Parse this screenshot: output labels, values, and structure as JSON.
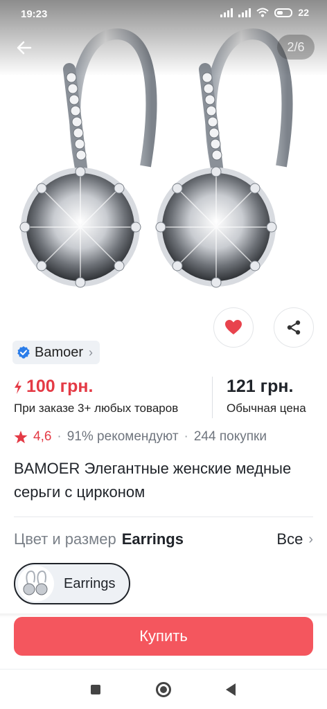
{
  "status_bar": {
    "time": "19:23",
    "battery": "22"
  },
  "gallery": {
    "counter": "2/6"
  },
  "seller": {
    "name": "Bamoer"
  },
  "price": {
    "promo": "100 грн.",
    "promo_note": "При заказе 3+ любых товаров",
    "regular": "121 грн.",
    "regular_note": "Обычная цена"
  },
  "rating": {
    "score": "4,6",
    "recommend": "91% рекомендуют",
    "purchases": "244 покупки"
  },
  "product": {
    "title": "BAMOER Элегантные женские медные серьги с цирконом"
  },
  "variant": {
    "label": "Цвет и размер",
    "selected": "Earrings",
    "all_label": "Все",
    "chip_label": "Earrings"
  },
  "buy": {
    "label": "Купить"
  },
  "colors": {
    "accent": "#f4565e",
    "price_red": "#e43a45",
    "verified_blue": "#2b7de9"
  }
}
